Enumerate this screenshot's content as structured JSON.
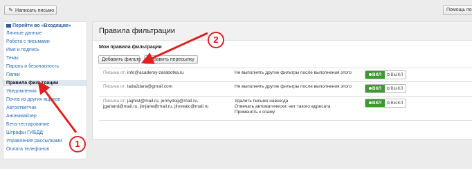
{
  "toolbar": {
    "compose_label": "Написать письмо",
    "help_label": "Помощь по р"
  },
  "sidebar": {
    "header": "Перейти во «Входящие»",
    "items": [
      {
        "label": "Личные данные"
      },
      {
        "label": "Работа с письмами"
      },
      {
        "label": "Имя и подпись"
      },
      {
        "label": "Темы"
      },
      {
        "label": "Пароль и безопасность"
      },
      {
        "label": "Папки"
      },
      {
        "label": "Правила фильтрации",
        "active": true
      },
      {
        "label": "Уведомления"
      },
      {
        "label": "Почта из других ящиков"
      },
      {
        "label": "Автоответчик"
      },
      {
        "label": "Анонимайзер"
      },
      {
        "label": "Бета-тестирование"
      },
      {
        "label": "Штрафы ГИБДД"
      },
      {
        "label": "Управление рассылками"
      },
      {
        "label": "Оплата телефонов"
      }
    ]
  },
  "main": {
    "title": "Правила фильтрации",
    "section_title": "Мои правила фильтрации",
    "add_filter_label": "Добавить фильтр",
    "add_forward_label": "Добавить пересылку",
    "filters": [
      {
        "cond_label": "Письма от:",
        "cond_value": "info@academy-zarabotka.ru",
        "actions": [
          "Не выполнять другие фильтры после выполнения этого"
        ]
      },
      {
        "cond_label": "Письма от:",
        "cond_value": "lada2dara@gmail.com",
        "actions": [
          "Не выполнять другие фильтры после выполнения этого"
        ]
      },
      {
        "cond_label": "Письма от:",
        "cond_value": "jaghist@mail.ru, jennydog@mail.ru,",
        "cond_more": [
          "jgarland@mail.ru, jimjane@mail.ru, jiloveaic@mail.ru"
        ],
        "actions": [
          "Удалить письмо навсегда",
          "Отвечать автоматически: нет такого адресата",
          "Применять к спаму"
        ]
      }
    ],
    "toggle_on": "ВКЛ",
    "toggle_off": "ВЫКЛ"
  },
  "annotations": {
    "badge_1": "1",
    "badge_2": "2",
    "color": "#e02020"
  }
}
